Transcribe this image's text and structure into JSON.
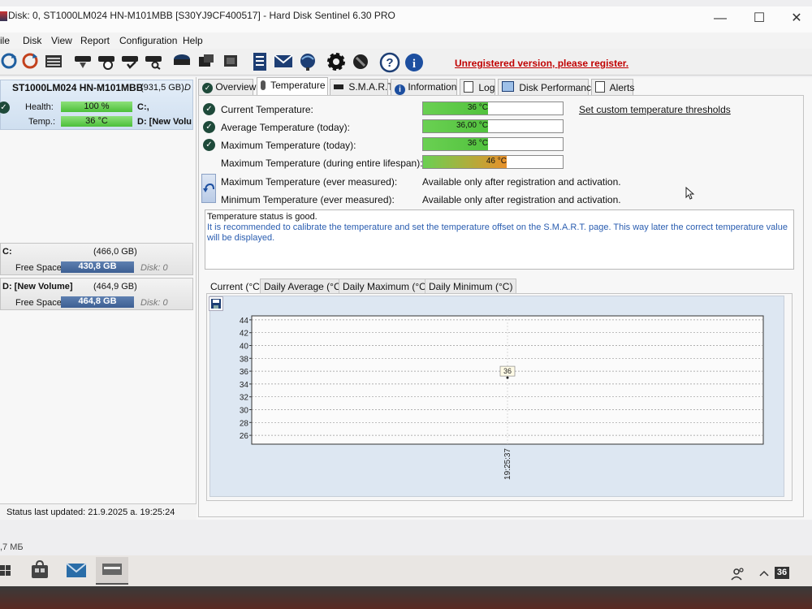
{
  "window": {
    "title": "Disk: 0, ST1000LM024 HN-M101MBB [S30YJ9CF400517]  -  Hard Disk Sentinel 6.30 PRO",
    "minimize_glyph": "—",
    "maximize_glyph": "☐",
    "close_glyph": "✕"
  },
  "menu": [
    "ile",
    "Disk",
    "View",
    "Report",
    "Configuration",
    "Help"
  ],
  "toolbar": {
    "icons": [
      "refresh-icon",
      "refresh-all-icon",
      "disk-list-icon",
      "disk-test-icon",
      "disk-schedule-icon",
      "disk-check-icon",
      "disk-search-icon",
      "drive-icon",
      "drive-group-icon",
      "drive-stack-icon",
      "report-icon",
      "email-icon",
      "network-icon",
      "settings-icon",
      "tools-icon",
      "help-icon",
      "info-icon"
    ],
    "unregistered_text": "Unregistered version, please register."
  },
  "left": {
    "disk_name": "ST1000LM024 HN-M101MBB",
    "disk_size": "(931,5 GB)",
    "disk_suffix": "D",
    "health_label": "Health:",
    "health_value": "100 %",
    "health_percent": 100,
    "temp_label": "Temp.:",
    "temp_value": "36 °C",
    "drive_c": "C:,",
    "drive_d": "D: [New Volu",
    "volumes": [
      {
        "name": "C:",
        "size": "(466,0 GB)",
        "free_label": "Free Space",
        "free_value": "430,8 GB",
        "disk": "Disk: 0"
      },
      {
        "name": "D: [New Volume]",
        "size": "(464,9 GB)",
        "free_label": "Free Space",
        "free_value": "464,8 GB",
        "disk": "Disk: 0"
      }
    ],
    "status_updated": "Status last updated: 21.9.2025 a. 19:25:24"
  },
  "tabs": [
    "Overview",
    "Temperature",
    "S.M.A.R.T.",
    "Information",
    "Log",
    "Disk Performance",
    "Alerts"
  ],
  "temperature": {
    "rows": [
      {
        "label": "Current Temperature:",
        "value": "36 °C",
        "fill": 0.36,
        "color": "#52c23e"
      },
      {
        "label": "Average Temperature (today):",
        "value": "36,00 °C",
        "fill": 0.36,
        "color": "#52c23e"
      },
      {
        "label": "Maximum Temperature (today):",
        "value": "36 °C",
        "fill": 0.36,
        "color": "#52c23e"
      },
      {
        "label": "Maximum Temperature (during entire lifespan):",
        "value": "46 °C",
        "fill": 0.46,
        "color": "#e8902a"
      }
    ],
    "ever_rows": [
      {
        "label": "Maximum Temperature (ever measured):",
        "value": "Available only after registration and activation."
      },
      {
        "label": "Minimum Temperature (ever measured):",
        "value": "Available only after registration and activation."
      }
    ],
    "thresholds_link": "Set custom temperature thresholds",
    "status_good": "Temperature status is good.",
    "status_note": "It is recommended to calibrate the temperature and set the temperature offset on the S.M.A.R.T. page. This way later the correct temperature value will be displayed.",
    "note_color": "#2a5db0"
  },
  "chart_tabs": [
    "Current (°C)",
    "Daily Average (°C)",
    "Daily Maximum (°C)",
    "Daily Minimum (°C)"
  ],
  "chart_data": {
    "type": "scatter",
    "x": [
      "19:25:37"
    ],
    "values": [
      36
    ],
    "data_label": "36",
    "y_ticks": [
      44,
      42,
      40,
      38,
      36,
      34,
      32,
      30,
      28,
      26
    ],
    "ylim": [
      25,
      45
    ],
    "grid": true
  },
  "taskbar": {
    "icons": [
      "start-icon",
      "store-icon",
      "mail-icon",
      "hdsentinel-taskbar-icon"
    ],
    "tray_text": "36"
  },
  "footer_text": ",7 МБ"
}
